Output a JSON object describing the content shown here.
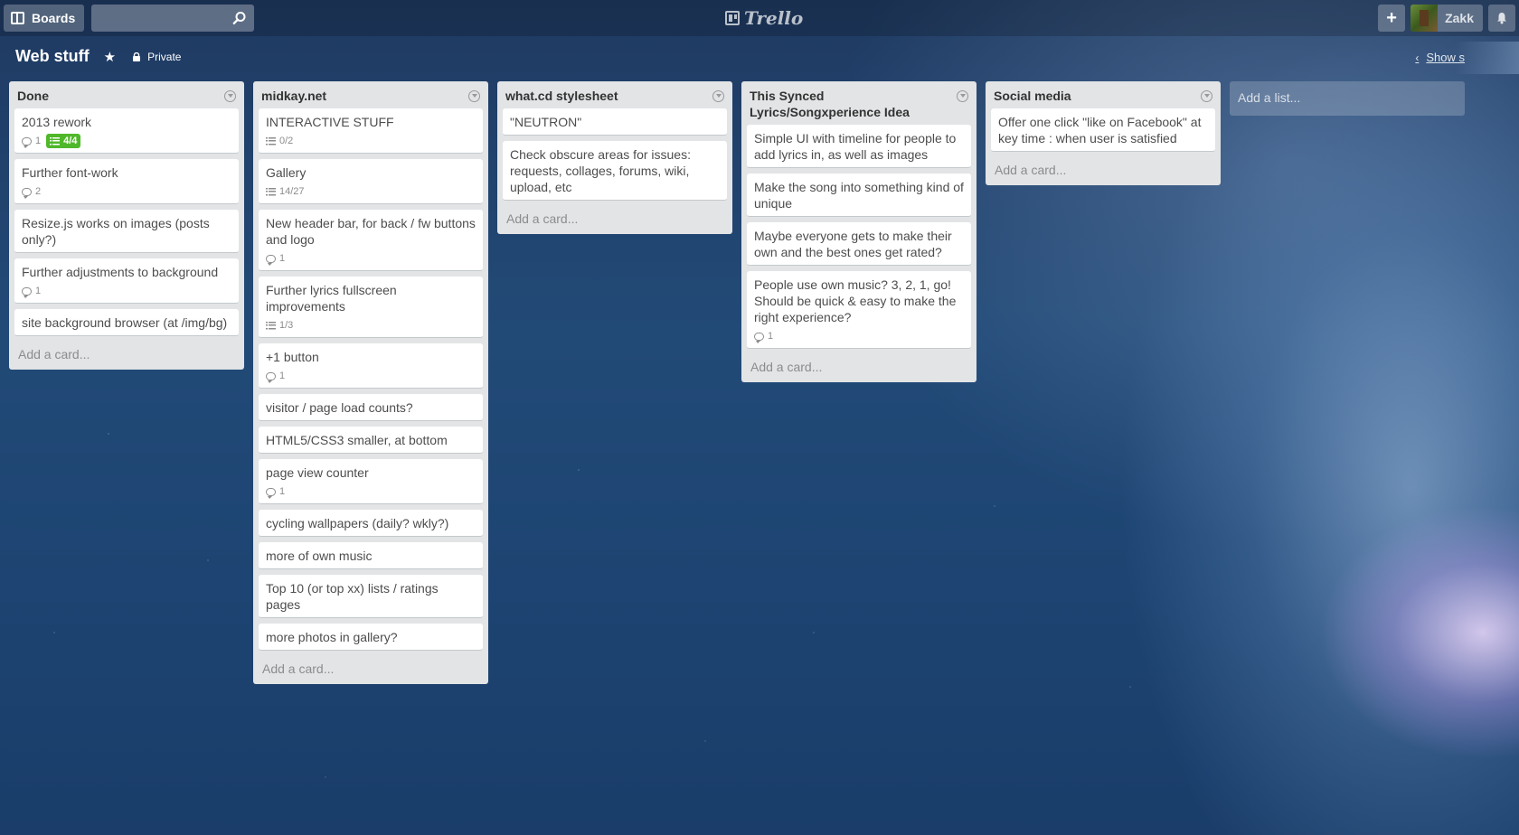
{
  "header": {
    "boards_label": "Boards",
    "search_placeholder": "",
    "logo_text": "Trello",
    "add_label": "+",
    "user_name": "Zakk"
  },
  "board": {
    "title": "Web stuff",
    "privacy": "Private",
    "show_menu": "Show s"
  },
  "lists": [
    {
      "title": "Done",
      "cards": [
        {
          "title": "2013 rework",
          "comments": "1",
          "checklist": "4/4",
          "checklist_done": true
        },
        {
          "title": "Further font-work",
          "comments": "2"
        },
        {
          "title": "Resize.js works on images (posts only?)"
        },
        {
          "title": "Further adjustments to background",
          "comments": "1"
        },
        {
          "title": "site background browser (at /img/bg)"
        }
      ],
      "add_card": "Add a card..."
    },
    {
      "title": "midkay.net",
      "cards": [
        {
          "title": "INTERACTIVE STUFF",
          "checklist": "0/2"
        },
        {
          "title": "Gallery",
          "checklist": "14/27"
        },
        {
          "title": "New header bar, for back / fw buttons and logo",
          "comments": "1"
        },
        {
          "title": "Further lyrics fullscreen improvements",
          "checklist": "1/3"
        },
        {
          "title": "+1 button",
          "comments": "1"
        },
        {
          "title": "visitor / page load counts?"
        },
        {
          "title": "HTML5/CSS3 smaller, at bottom"
        },
        {
          "title": "page view counter",
          "comments": "1"
        },
        {
          "title": "cycling wallpapers (daily? wkly?)"
        },
        {
          "title": "more of own music"
        },
        {
          "title": "Top 10 (or top xx) lists / ratings pages"
        },
        {
          "title": "more photos in gallery?"
        }
      ],
      "add_card": "Add a card..."
    },
    {
      "title": "what.cd stylesheet",
      "cards": [
        {
          "title": "\"NEUTRON\""
        },
        {
          "title": "Check obscure areas for issues: requests, collages, forums, wiki, upload, etc"
        }
      ],
      "add_card": "Add a card..."
    },
    {
      "title": "This Synced Lyrics/Songxperience Idea",
      "cards": [
        {
          "title": "Simple UI with timeline for people to add lyrics in, as well as images"
        },
        {
          "title": "Make the song into something kind of unique"
        },
        {
          "title": "Maybe everyone gets to make their own and the best ones get rated?"
        },
        {
          "title": "People use own music? 3, 2, 1, go! Should be quick & easy to make the right experience?",
          "comments": "1"
        }
      ],
      "add_card": "Add a card..."
    },
    {
      "title": "Social media",
      "cards": [
        {
          "title": "Offer one click \"like on Facebook\" at key time : when user is satisfied"
        }
      ],
      "add_card": "Add a card..."
    }
  ],
  "add_list_label": "Add a list..."
}
